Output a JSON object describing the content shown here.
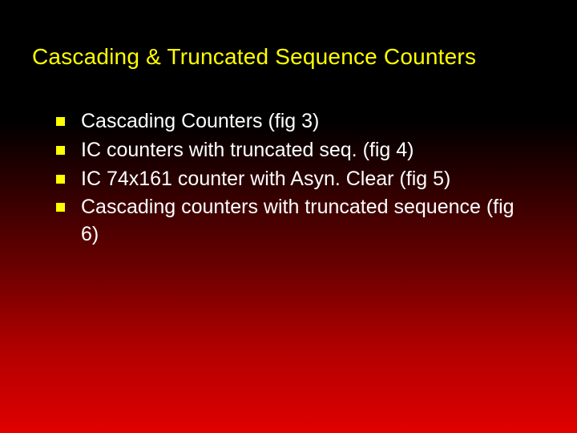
{
  "title": "Cascading  & Truncated Sequence Counters",
  "bullets": [
    "Cascading Counters (fig 3)",
    "IC counters with truncated seq. (fig 4)",
    "IC 74x161 counter with Asyn. Clear (fig 5)",
    "Cascading counters with truncated sequence (fig 6)"
  ]
}
